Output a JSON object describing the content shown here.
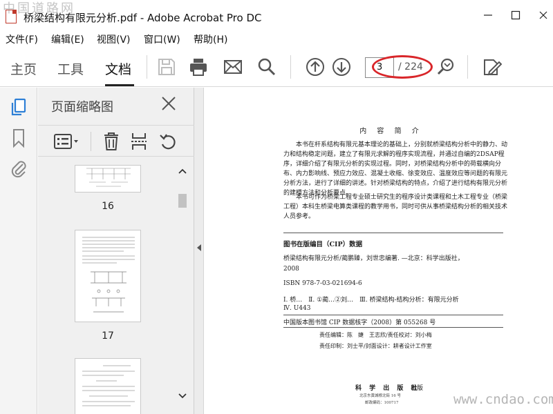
{
  "window": {
    "title": "桥梁结构有限元分析.pdf - Adobe Acrobat Pro DC",
    "watermark_cn": "中国道路网",
    "watermark_url": "www.cndao.com"
  },
  "menu": [
    "文件(F)",
    "编辑(E)",
    "视图(V)",
    "窗口(W)",
    "帮助(H)"
  ],
  "tabs": {
    "home": "主页",
    "tools": "工具",
    "document": "文档"
  },
  "navigation": {
    "current_page": "3",
    "total_pages": "/ 224"
  },
  "thumbnail_panel": {
    "title": "页面缩略图",
    "pages": [
      "16",
      "17"
    ]
  },
  "document": {
    "heading": "内 容 简 介",
    "intro_paragraph_1": "本书在杆系结构有限元基本理论的基础上，分别就桥梁结构分析中的静力、动力和结构稳定问题，建立了有限元求解的程序实现流程，并通过自编的2DSAP程序，详细介绍了有限元分析的实现过程。同时，对桥梁结构分析中的荷载横向分布、内力影响线、预应力效应、混凝土收缩、徐变效应、温度效应等问题的有限元分析方法，进行了详细的讲述。针对桥梁结构的特点，介绍了进行结构有限元分析的建模方法和分析要点。",
    "intro_paragraph_2": "本书可作为桥梁工程专业硕士研究生的程序设计类课程和土木工程专业（桥梁工程）本科生桥梁电算类课程的教学用书，同时可供从事桥梁结构分析的相关技术人员参考。",
    "cip_title": "图书在版编目（CIP）数据",
    "cip_line_1": "桥梁结构有限元分析/蔺鹏臻，刘世忠编著. —北京：科学出版社，",
    "cip_line_2": "2008",
    "isbn": "ISBN 978-7-03-021694-6",
    "cip_class_1": "Ⅰ. 桥…　Ⅱ. ①蔺…②刘…　Ⅲ. 桥梁结构-结构分析：有限元分析",
    "cip_class_2": "Ⅳ. U443",
    "cip_core": "中国版本图书馆 CIP 数据核字（2008）第 055268 号",
    "editors_1": "责任编辑：陈　婕　王志欣/责任校对：刘小梅",
    "editors_2": "责任印制：刘士平/封面设计：耕者设计工作室",
    "publisher_name": "科 学 出 版 社",
    "publisher_suffix": "出版",
    "publisher_addr": "北京东黄城根北街 16 号",
    "publisher_zip": "邮政编码：100717"
  }
}
